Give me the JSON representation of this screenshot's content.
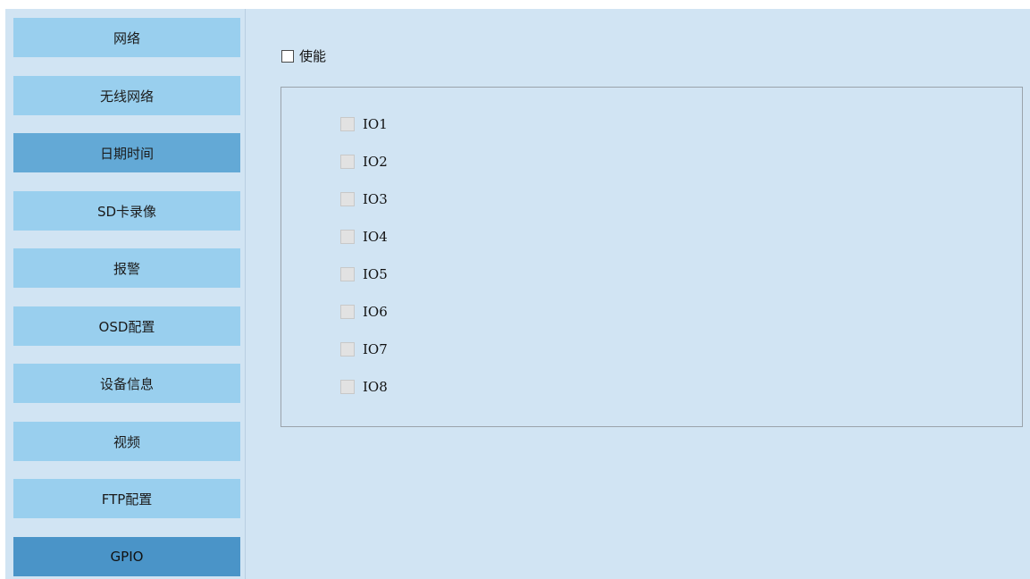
{
  "sidebar": {
    "items": [
      {
        "label": "网络"
      },
      {
        "label": "无线网络"
      },
      {
        "label": "日期时间"
      },
      {
        "label": "SD卡录像"
      },
      {
        "label": "报警"
      },
      {
        "label": "OSD配置"
      },
      {
        "label": "设备信息"
      },
      {
        "label": "视频"
      },
      {
        "label": "FTP配置"
      },
      {
        "label": "GPIO"
      }
    ],
    "selected": "GPIO"
  },
  "main": {
    "enable": {
      "label": "使能",
      "checked": false
    },
    "io_group": {
      "enabled": false,
      "items": [
        {
          "label": "IO1",
          "checked": false
        },
        {
          "label": "IO2",
          "checked": false
        },
        {
          "label": "IO3",
          "checked": false
        },
        {
          "label": "IO4",
          "checked": false
        },
        {
          "label": "IO5",
          "checked": false
        },
        {
          "label": "IO6",
          "checked": false
        },
        {
          "label": "IO7",
          "checked": false
        },
        {
          "label": "IO8",
          "checked": false
        }
      ]
    }
  },
  "colors": {
    "panel_bg": "#d1e4f3",
    "nav_button": "#99cfee",
    "nav_button_highlight": "#63a9d6",
    "nav_button_selected": "#4a94c8"
  }
}
